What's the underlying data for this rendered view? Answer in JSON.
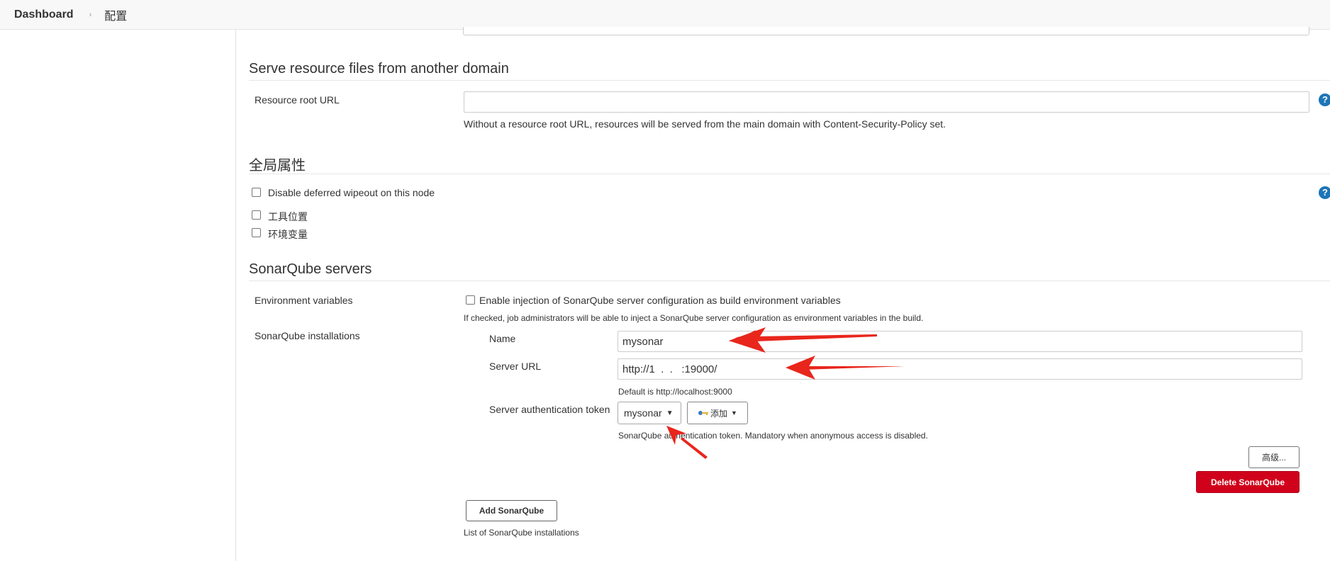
{
  "breadcrumb": {
    "items": [
      {
        "label": "Dashboard"
      },
      {
        "label": "配置"
      }
    ],
    "separator": "›"
  },
  "resource_section": {
    "title": "Serve resource files from another domain",
    "field_label": "Resource root URL",
    "field_value": "",
    "description": "Without a resource root URL, resources will be served from the main domain with Content-Security-Policy set."
  },
  "global_props": {
    "title": "全局属性",
    "checkboxes": [
      {
        "label": "Disable deferred wipeout on this node",
        "checked": false
      },
      {
        "label": "工具位置",
        "checked": false
      },
      {
        "label": "环境变量",
        "checked": false
      }
    ]
  },
  "sonarqube": {
    "title": "SonarQube servers",
    "env_vars_label": "Environment variables",
    "env_vars_checkbox_label": "Enable injection of SonarQube server configuration as build environment variables",
    "env_vars_checked": false,
    "env_vars_desc": "If checked, job administrators will be able to inject a SonarQube server configuration as environment variables in the build.",
    "installations_label": "SonarQube installations",
    "name_label": "Name",
    "name_value": "mysonar",
    "server_url_label": "Server URL",
    "server_url_value": "http://1  .  .   :19000/",
    "server_url_desc": "Default is http://localhost:9000",
    "token_label": "Server authentication token",
    "token_selected": "mysonar",
    "add_button_label": "添加",
    "token_desc": "SonarQube authentication token. Mandatory when anonymous access is disabled.",
    "advanced_button_label": "高级...",
    "delete_button_label": "Delete SonarQube",
    "add_sonarqube_label": "Add SonarQube",
    "list_desc": "List of SonarQube installations"
  },
  "help_icon_glyph": "?",
  "colors": {
    "accent_red": "#d0021b",
    "help_blue": "#1c75b8",
    "arrow_red": "#e8261c"
  }
}
